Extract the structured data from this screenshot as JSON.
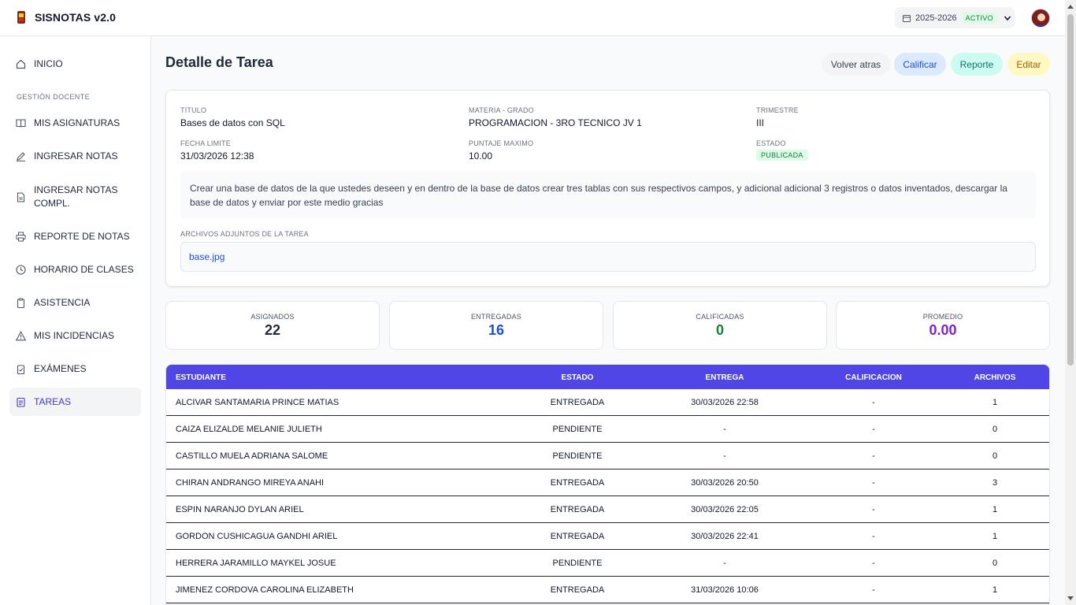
{
  "app": {
    "title": "SISNOTAS v2.0"
  },
  "header": {
    "period": "2025-2026",
    "period_status": "ACTIVO"
  },
  "sidebar": {
    "section_label": "GESTIÓN DOCENTE",
    "items": [
      {
        "label": "INICIO",
        "icon": "home-icon"
      },
      {
        "label": "MIS ASIGNATURAS",
        "icon": "book-icon"
      },
      {
        "label": "INGRESAR NOTAS",
        "icon": "edit-icon"
      },
      {
        "label": "INGRESAR NOTAS COMPL.",
        "icon": "file-icon"
      },
      {
        "label": "REPORTE DE NOTAS",
        "icon": "printer-icon"
      },
      {
        "label": "HORARIO DE CLASES",
        "icon": "clock-icon"
      },
      {
        "label": "ASISTENCIA",
        "icon": "clipboard-icon"
      },
      {
        "label": "MIS INCIDENCIAS",
        "icon": "warning-icon"
      },
      {
        "label": "EXÁMENES",
        "icon": "checklist-icon"
      },
      {
        "label": "TAREAS",
        "icon": "task-icon"
      }
    ]
  },
  "page": {
    "title": "Detalle de Tarea",
    "actions": {
      "back": "Volver atras",
      "grade": "Calificar",
      "report": "Reporte",
      "edit": "Editar"
    }
  },
  "task": {
    "title_label": "TITULO",
    "title": "Bases de datos con SQL",
    "subject_label": "MATERIA - GRADO",
    "subject": "PROGRAMACION - 3RO TECNICO JV 1",
    "term_label": "TRIMESTRE",
    "term": "III",
    "due_label": "FECHA LIMITE",
    "due": "31/03/2026 12:38",
    "max_label": "PUNTAJE MAXIMO",
    "max": "10.00",
    "status_label": "ESTADO",
    "status": "PUBLICADA",
    "description": "Crear una base de datos de la que ustedes deseen y en dentro de la base de datos crear tres tablas con sus respectivos campos, y adicional adicional 3 registros o datos inventados, descargar la base de datos y enviar por este medio gracias",
    "attachments_label": "ARCHIVOS ADJUNTOS DE LA TAREA",
    "attachment": "base.jpg"
  },
  "stats": [
    {
      "label": "ASIGNADOS",
      "value": "22",
      "color": "#1f2937"
    },
    {
      "label": "ENTREGADAS",
      "value": "16",
      "color": "#1d4ed8"
    },
    {
      "label": "CALIFICADAS",
      "value": "0",
      "color": "#15803d"
    },
    {
      "label": "PROMEDIO",
      "value": "0.00",
      "color": "#7e22ce"
    }
  ],
  "table": {
    "headers": [
      "ESTUDIANTE",
      "ESTADO",
      "ENTREGA",
      "CALIFICACION",
      "ARCHIVOS"
    ],
    "rows": [
      [
        "ALCIVAR SANTAMARIA PRINCE MATIAS",
        "ENTREGADA",
        "30/03/2026 22:58",
        "-",
        "1"
      ],
      [
        "CAIZA ELIZALDE MELANIE JULIETH",
        "PENDIENTE",
        "-",
        "-",
        "0"
      ],
      [
        "CASTILLO MUELA ADRIANA SALOME",
        "PENDIENTE",
        "-",
        "-",
        "0"
      ],
      [
        "CHIRAN ANDRANGO MIREYA ANAHI",
        "ENTREGADA",
        "30/03/2026 20:50",
        "-",
        "3"
      ],
      [
        "ESPIN NARANJO DYLAN ARIEL",
        "ENTREGADA",
        "30/03/2026 22:05",
        "-",
        "1"
      ],
      [
        "GORDON CUSHICAGUA GANDHI ARIEL",
        "ENTREGADA",
        "30/03/2026 22:41",
        "-",
        "1"
      ],
      [
        "HERRERA JARAMILLO MAYKEL JOSUE",
        "PENDIENTE",
        "-",
        "-",
        "0"
      ],
      [
        "JIMENEZ CORDOVA CAROLINA ELIZABETH",
        "ENTREGADA",
        "31/03/2026 10:06",
        "-",
        "1"
      ]
    ]
  }
}
